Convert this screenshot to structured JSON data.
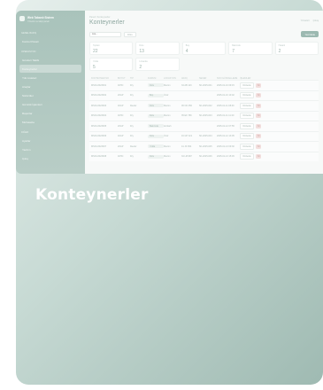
{
  "app": {
    "brand_name": "Web Tabanlı Sistem",
    "brand_sub": "Yönetim ve takip paneli"
  },
  "sidebar": {
    "groups": [
      {
        "label": "Genel Bakış"
      },
      {
        "label": "Operasyon"
      },
      {
        "label": "Diğer"
      }
    ],
    "items": [
      {
        "label": "Kontrol Paneli"
      },
      {
        "label": "Gönderi Takibi"
      },
      {
        "label": "Konteynerler",
        "active": true
      },
      {
        "label": "Yük Listeleri"
      },
      {
        "label": "Araçlar"
      },
      {
        "label": "Sürücüler"
      },
      {
        "label": "Gümrük İşlemleri"
      },
      {
        "label": "Raporlar"
      },
      {
        "label": "Muhasebe"
      },
      {
        "label": "Ayarlar"
      },
      {
        "label": "Yardım"
      },
      {
        "label": "Çıkış"
      }
    ]
  },
  "header": {
    "breadcrumb": "Panel / Konteynerler",
    "title": "Konteynerler",
    "user_label": "Yönetici",
    "logout_label": "Çıkış"
  },
  "toolbar": {
    "search_placeholder": "Ara...",
    "filter_label": "Filtre",
    "new_label": "Yeni Ekle"
  },
  "stats": [
    {
      "label": "Toplam",
      "value": "22"
    },
    {
      "label": "Dolu",
      "value": "13"
    },
    {
      "label": "Boş",
      "value": "4"
    },
    {
      "label": "Bakımda",
      "value": "7"
    },
    {
      "label": "Hasarlı",
      "value": "2"
    },
    {
      "label": "Yolda",
      "value": "5"
    },
    {
      "label": "Limanda",
      "value": "2"
    }
  ],
  "table": {
    "columns": [
      "Konteyner No",
      "Boyut",
      "Tip",
      "Durum",
      "Lokasyon",
      "Araç",
      "Sefer",
      "Son Güncelleme",
      "İşlemler"
    ],
    "rows": [
      {
        "no": "MSCU2023001",
        "size": "40HC",
        "type": "Dry",
        "status": "Dolu",
        "loc": "Mersin",
        "vehicle": "34 AB 123",
        "trip": "SF-2025-001",
        "updated": "2025-01-10 09:15"
      },
      {
        "no": "MSCU2023002",
        "size": "20GP",
        "type": "Dry",
        "status": "Boş",
        "loc": "İzmir",
        "vehicle": "",
        "trip": "",
        "updated": "2025-01-10 10:02"
      },
      {
        "no": "MSCU2023003",
        "size": "40GP",
        "type": "Reefer",
        "status": "Dolu",
        "loc": "Mersin",
        "vehicle": "06 CD 456",
        "trip": "SF-2025-002",
        "updated": "2025-01-11 08:40"
      },
      {
        "no": "MSCU2023004",
        "size": "40HC",
        "type": "Dry",
        "status": "Dolu",
        "loc": "Mersin",
        "vehicle": "35 EF 789",
        "trip": "SF-2025-003",
        "updated": "2025-01-11 11:20"
      },
      {
        "no": "MSCU2023005",
        "size": "20GP",
        "type": "Dry",
        "status": "Bakımda",
        "loc": "Ambarlı",
        "vehicle": "",
        "trip": "",
        "updated": "2025-01-12 07:55"
      },
      {
        "no": "MSCU2023006",
        "size": "40GP",
        "type": "Dry",
        "status": "Dolu",
        "loc": "İzmir",
        "vehicle": "16 GH 321",
        "trip": "SF-2025-004",
        "updated": "2025-01-12 13:05"
      },
      {
        "no": "MSCU2023007",
        "size": "20GP",
        "type": "Reefer",
        "status": "Yolda",
        "loc": "Mersin",
        "vehicle": "41 JK 654",
        "trip": "SF-2025-005",
        "updated": "2025-01-13 09:30"
      },
      {
        "no": "MSCU2023008",
        "size": "40HC",
        "type": "Dry",
        "status": "Dolu",
        "loc": "Mersin",
        "vehicle": "34 LM 987",
        "trip": "SF-2025-006",
        "updated": "2025-01-13 15:45"
      }
    ],
    "edit_label": "Düzenle",
    "delete_label": "Sil"
  },
  "caption": "Konteynerler"
}
